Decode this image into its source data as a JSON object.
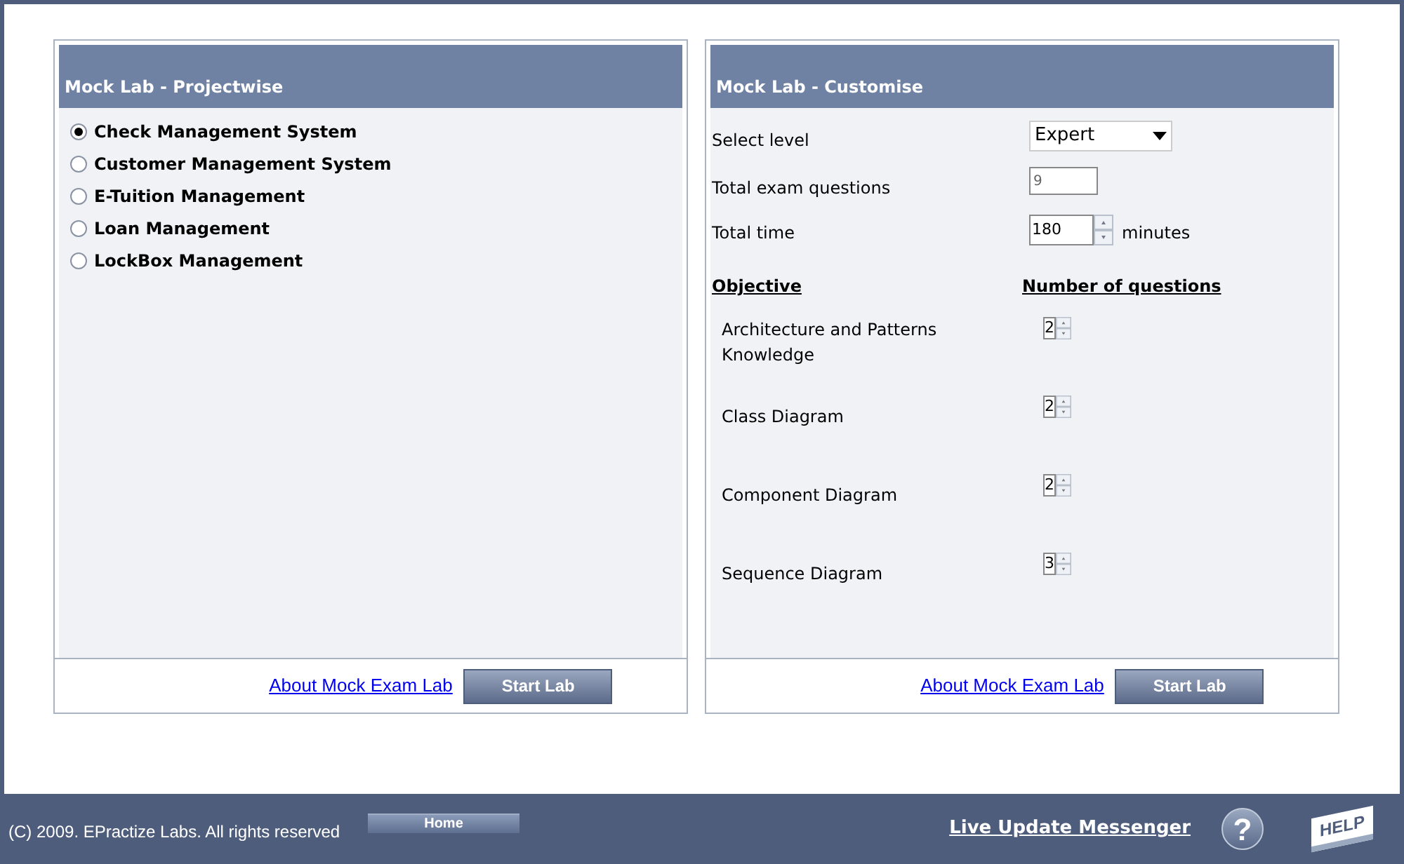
{
  "left_panel": {
    "title": "Mock Lab - Projectwise",
    "options": [
      {
        "label": "Check Management System",
        "selected": true
      },
      {
        "label": "Customer Management System",
        "selected": false
      },
      {
        "label": "E-Tuition Management",
        "selected": false
      },
      {
        "label": "Loan Management",
        "selected": false
      },
      {
        "label": "LockBox Management",
        "selected": false
      }
    ],
    "footer": {
      "link": "About Mock Exam Lab",
      "button": "Start Lab"
    }
  },
  "right_panel": {
    "title": "Mock Lab - Customise",
    "level": {
      "label": "Select level",
      "value": "Expert"
    },
    "total_questions": {
      "label": "Total exam questions",
      "value": "9"
    },
    "total_time": {
      "label": "Total time",
      "value": "180",
      "unit": "minutes"
    },
    "columns": [
      "Objective",
      "Number of questions"
    ],
    "objectives": [
      {
        "name": "Architecture and Patterns Knowledge",
        "count": "2"
      },
      {
        "name": "Class Diagram",
        "count": "2"
      },
      {
        "name": "Component Diagram",
        "count": "2"
      },
      {
        "name": "Sequence Diagram",
        "count": "3"
      }
    ],
    "footer": {
      "link": "About Mock Exam Lab",
      "button": "Start Lab"
    }
  },
  "footer": {
    "copyright": "(C) 2009. EPractize Labs. All rights reserved",
    "home_button": "Home",
    "messenger_link": "Live Update Messenger",
    "help_glyph": "?",
    "help_badge": "HELP"
  }
}
